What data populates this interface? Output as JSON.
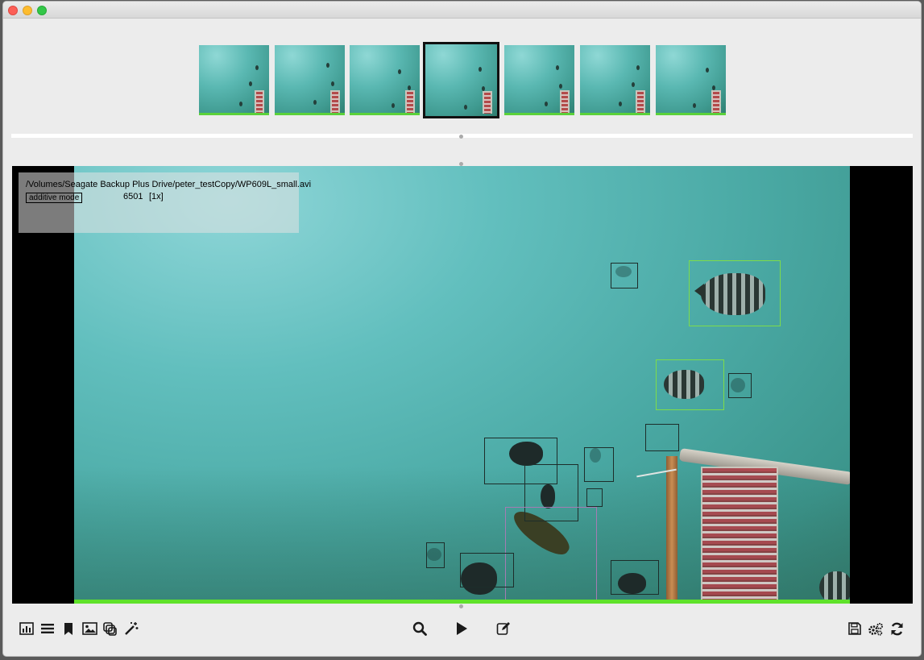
{
  "window": {
    "traffic_lights": [
      "close",
      "minimize",
      "zoom"
    ]
  },
  "filmstrip": {
    "count": 7,
    "selected_index": 3
  },
  "overlay": {
    "file_path": "/Volumes/Seagate Backup Plus Drive/peter_testCopy/WP609L_small.avi",
    "mode_label": "additive mode",
    "frame_number": "6501",
    "speed": "[1x]"
  },
  "colors": {
    "progress": "#5fe22a",
    "box_default": "#1d2d2a",
    "box_green": "#7edc4a",
    "box_purple": "#a57bb3"
  },
  "toolbar": {
    "left": [
      "bar-chart-icon",
      "list-icon",
      "bookmark-icon",
      "image-icon",
      "layers-icon",
      "magic-wand-icon"
    ],
    "center": [
      "search-icon",
      "play-icon",
      "edit-icon"
    ],
    "right": [
      "save-icon",
      "settings-icon",
      "refresh-icon"
    ]
  }
}
